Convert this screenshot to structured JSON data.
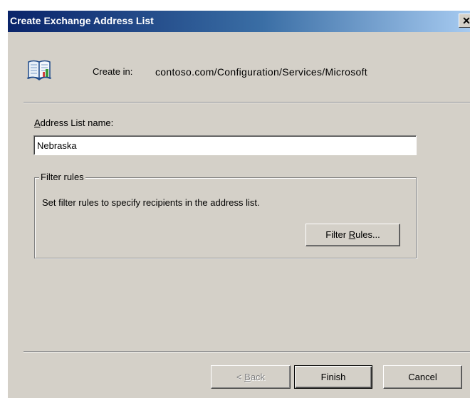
{
  "window": {
    "title": "Create Exchange Address List",
    "close_glyph": "✕"
  },
  "header": {
    "icon": "open-book-icon",
    "create_in_label": "Create in:",
    "create_in_path": "contoso.com/Configuration/Services/Microsoft"
  },
  "form": {
    "name_label_mnemonic": "A",
    "name_label_rest": "ddress List name:",
    "name_value": "Nebraska"
  },
  "filter_group": {
    "legend": "Filter rules",
    "description": "Set filter rules to specify recipients in the address list.",
    "button_prefix": "Filter ",
    "button_mnemonic": "R",
    "button_suffix": "ules..."
  },
  "footer": {
    "back_prefix": "< ",
    "back_mnemonic": "B",
    "back_suffix": "ack",
    "back_enabled": false,
    "finish_label": "Finish",
    "cancel_label": "Cancel"
  },
  "colors": {
    "dialog_bg": "#d4d0c8",
    "title_start": "#0a246a",
    "title_end": "#a6caf0"
  }
}
